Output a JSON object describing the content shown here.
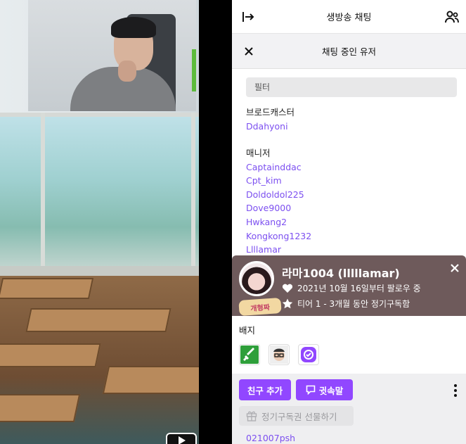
{
  "chat_header": {
    "title": "생방송 채팅"
  },
  "users_header": {
    "title": "채팅 중인 유저"
  },
  "filter": {
    "placeholder": "필터"
  },
  "sections": {
    "broadcaster": {
      "title": "브로드캐스터",
      "users": [
        "Ddahyoni"
      ]
    },
    "managers": {
      "title": "매니저",
      "users": [
        "Captainddac",
        "Cpt_kim",
        "Doldoldol225",
        "Dove9000",
        "Hwkang2",
        "Kongkong1232",
        "Llllamar"
      ]
    }
  },
  "user_card": {
    "name": "라마1004 (lllllamar)",
    "follow_text": "2021년 10월 16일부터 팔로우 중",
    "sub_text": "티어 1 - 3개월 동안 정기구독함",
    "avatar_sticker": "개형짜",
    "badges_title": "배지",
    "badges": [
      "sword-badge",
      "glasses-face-badge",
      "purple-check-badge"
    ],
    "add_friend_label": "친구 추가",
    "whisper_label": "귓속말",
    "gift_label": "정기구독권 선물하기",
    "peek_user": "021007psh"
  },
  "colors": {
    "accent": "#9147ff",
    "link": "#7c4ff0",
    "banner": "#6e5a5b"
  }
}
